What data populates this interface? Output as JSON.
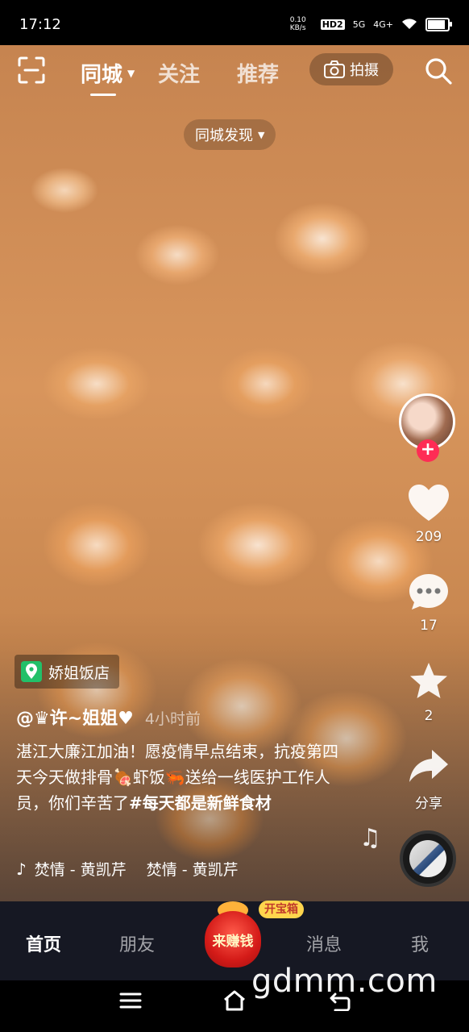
{
  "status": {
    "time": "17:12",
    "net_speed": "0.10 KB/s",
    "hd": "HD2",
    "signal_5g": "5G",
    "signal_4g": "4G+"
  },
  "top_nav": {
    "tabs": [
      "同城",
      "关注",
      "推荐"
    ],
    "shoot_label": "拍摄"
  },
  "city_filter": "同城发现",
  "actions": {
    "likes": "209",
    "comments": "17",
    "favorites": "2",
    "share_label": "分享"
  },
  "post": {
    "poi": "娇姐饭店",
    "author": "@♛许~姐姐♥",
    "time_ago": "4小时前",
    "caption_1": "湛江大廉江加油！愿疫情早点结束，抗疫第四天今天做排骨🍖虾饭🦐送给一线医护工作人员，你们辛苦了",
    "caption_hash": "#每天都是新鲜食材",
    "music": "焚情 - 黄凯芹　 焚情 - 黄凯芹"
  },
  "bottom_tabs": {
    "home": "首页",
    "friends": "朋友",
    "earn": "来赚钱",
    "treasure": "开宝箱",
    "messages": "消息",
    "me": "我"
  },
  "watermark": "gdmm.com",
  "colors": {
    "accent": "#fe2c55",
    "poi_green": "#22c069",
    "tabbar_bg": "#161823"
  }
}
